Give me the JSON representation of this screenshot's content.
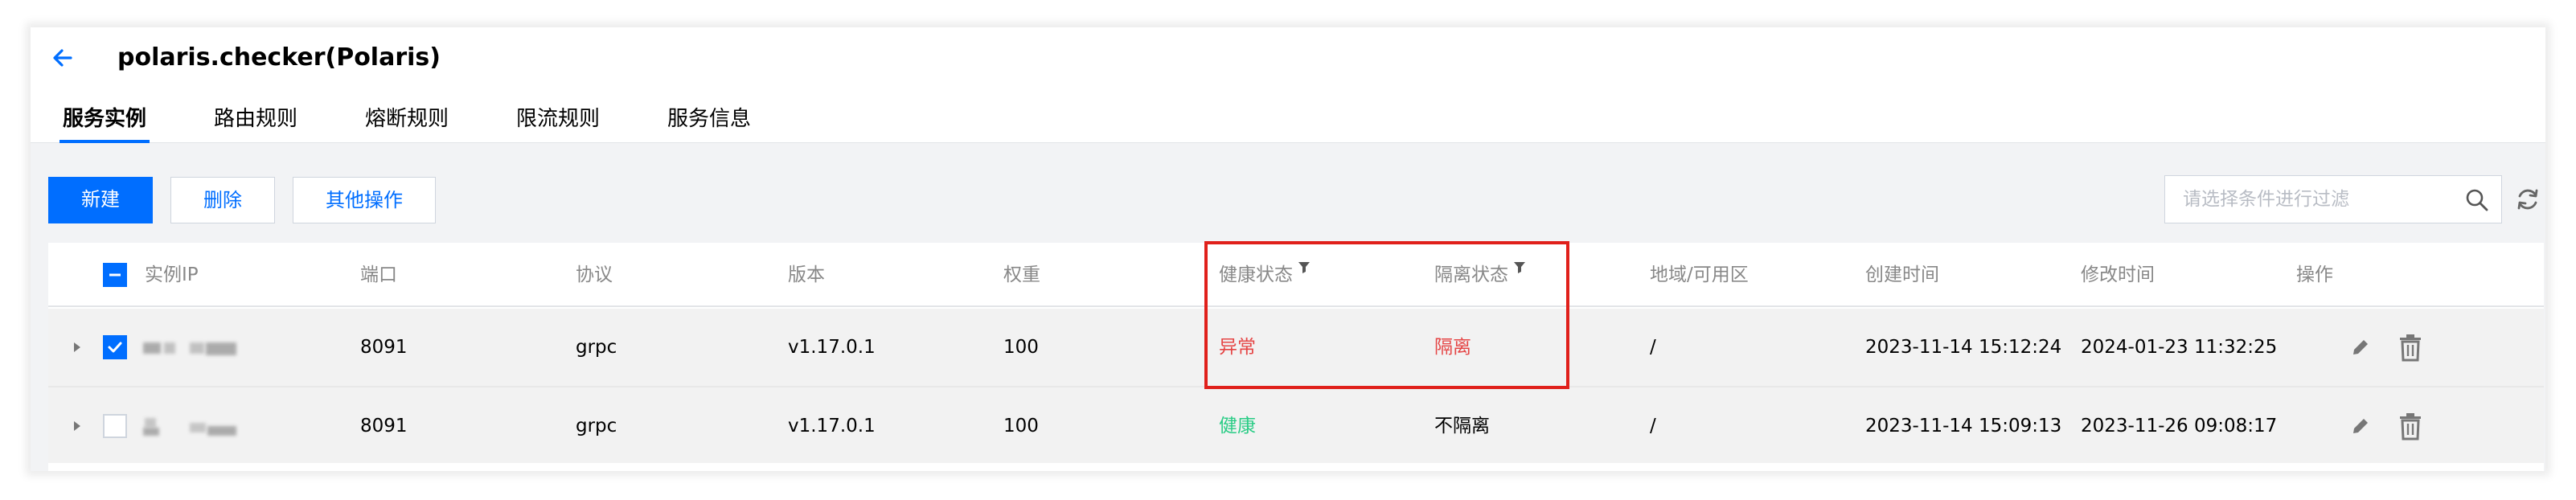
{
  "header": {
    "title": "polaris.checker(Polaris)"
  },
  "tabs": [
    {
      "label": "服务实例",
      "active": true
    },
    {
      "label": "路由规则",
      "active": false
    },
    {
      "label": "熔断规则",
      "active": false
    },
    {
      "label": "限流规则",
      "active": false
    },
    {
      "label": "服务信息",
      "active": false
    }
  ],
  "toolbar": {
    "new_label": "新建",
    "delete_label": "删除",
    "more_label": "其他操作",
    "search_placeholder": "请选择条件进行过滤"
  },
  "table": {
    "columns": {
      "ip": "实例IP",
      "port": "端口",
      "protocol": "协议",
      "version": "版本",
      "weight": "权重",
      "health": "健康状态",
      "isolate": "隔离状态",
      "region": "地域/可用区",
      "created": "创建时间",
      "modified": "修改时间",
      "actions": "操作"
    },
    "rows": [
      {
        "checked": true,
        "port": "8091",
        "protocol": "grpc",
        "version": "v1.17.0.1",
        "weight": "100",
        "health": "异常",
        "isolate": "隔离",
        "region": "/",
        "created": "2023-11-14 15:12:24",
        "modified": "2024-01-23 11:32:25"
      },
      {
        "checked": false,
        "port": "8091",
        "protocol": "grpc",
        "version": "v1.17.0.1",
        "weight": "100",
        "health": "健康",
        "isolate": "不隔离",
        "region": "/",
        "created": "2023-11-14 15:09:13",
        "modified": "2023-11-26 09:08:17"
      }
    ]
  },
  "colors": {
    "primary": "#006eff",
    "error": "#e54545",
    "success": "#29cc85",
    "highlight": "#e0201b"
  },
  "icons": [
    "back-arrow-icon",
    "search-icon",
    "refresh-icon",
    "filter-icon",
    "caret-right-icon",
    "edit-icon",
    "trash-icon"
  ]
}
